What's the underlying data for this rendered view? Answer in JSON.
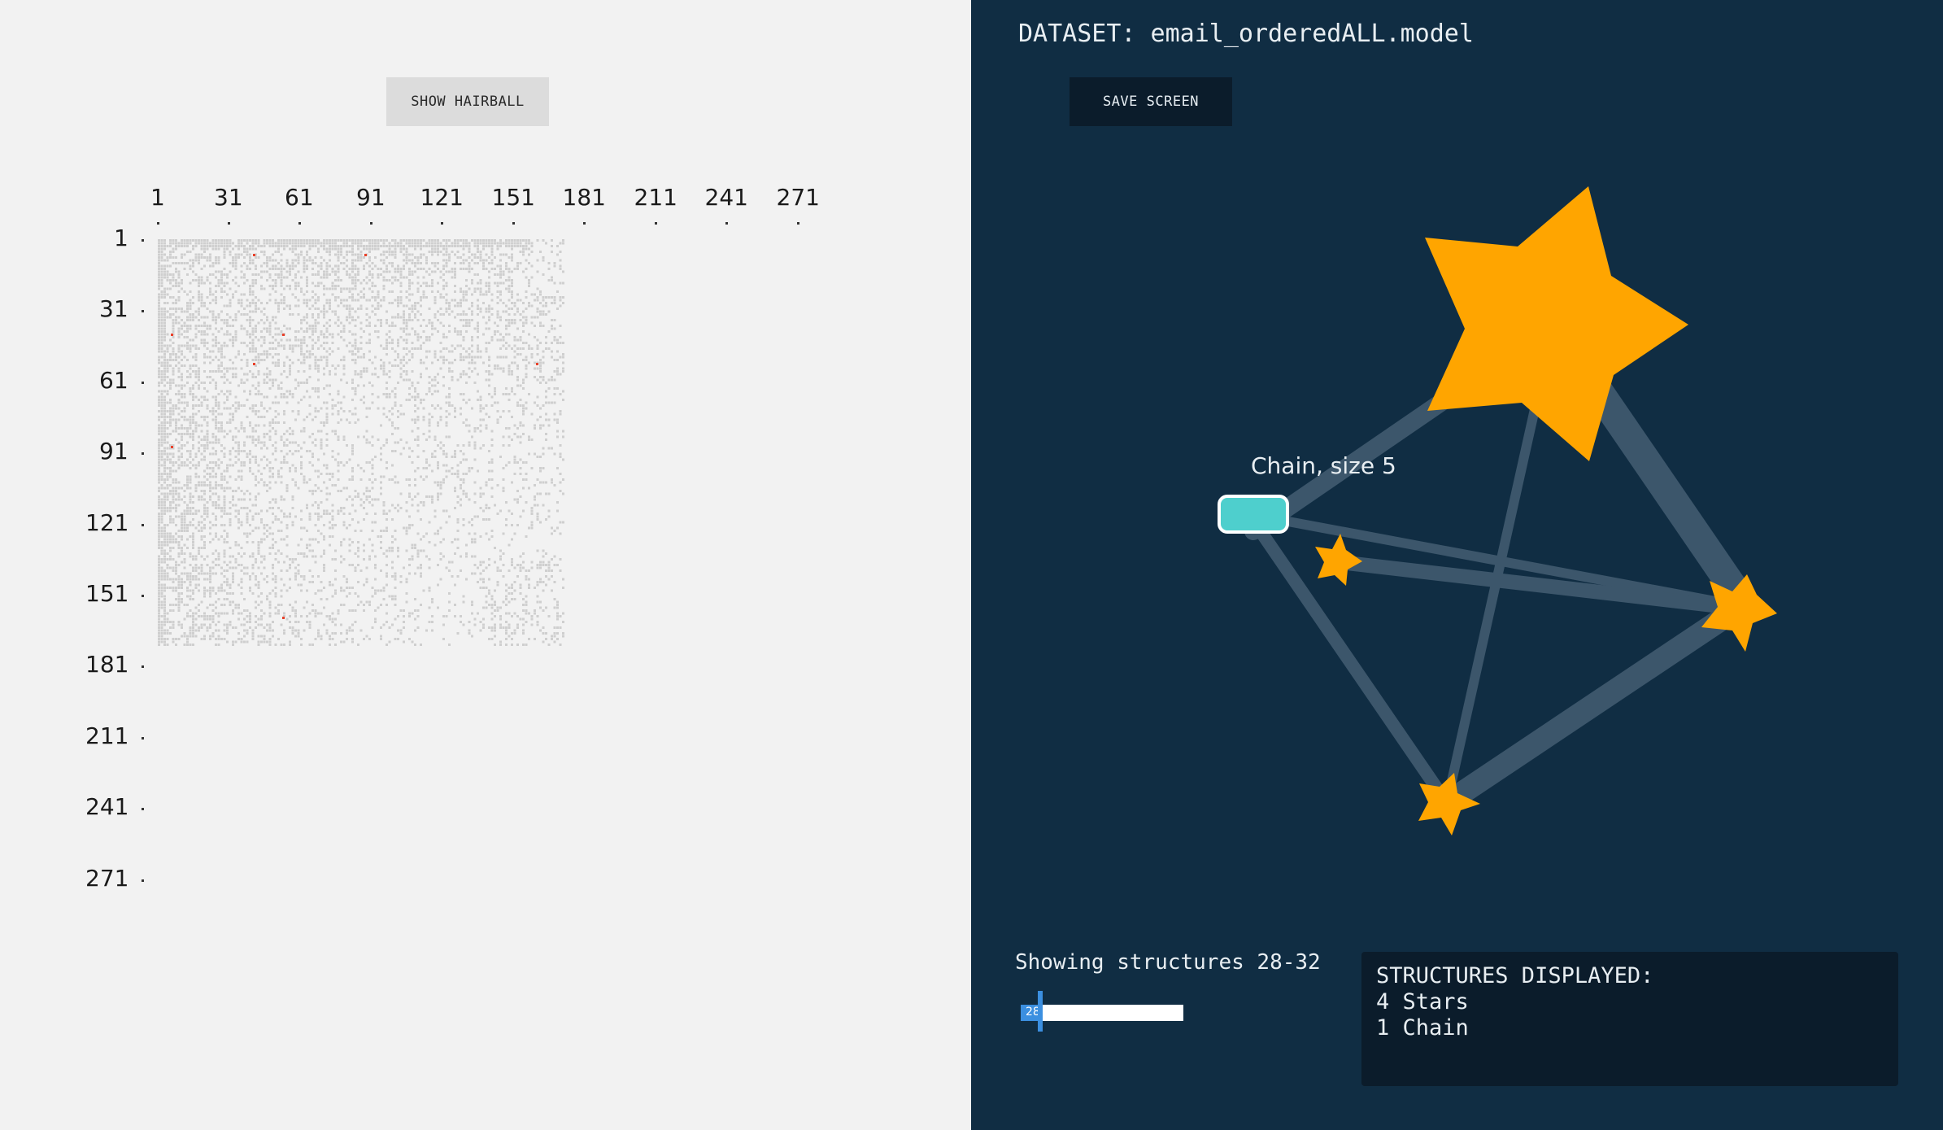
{
  "left_panel": {
    "hairball_button": "SHOW HAIRBALL",
    "matrix": {
      "column_ticks": [
        "1",
        "31",
        "61",
        "91",
        "121",
        "151",
        "181",
        "211",
        "241",
        "271"
      ],
      "row_ticks": [
        "1",
        "31",
        "61",
        "91",
        "121",
        "151",
        "181",
        "211",
        "241",
        "271"
      ],
      "highlight_color": "#e8412a",
      "cell_color": "#cfcfcf"
    }
  },
  "right_panel": {
    "dataset_label": "DATASET: email_orderedALL.model",
    "save_button": "SAVE SCREEN",
    "graph": {
      "chain_label": "Chain, size 5",
      "star_color": "#ffa500",
      "chain_color": "#4ecfcd",
      "edge_color": "#4a6478"
    },
    "slider": {
      "caption": "Showing structures 28-32",
      "value": "28"
    },
    "summary": {
      "heading": "STRUCTURES DISPLAYED:",
      "lines": [
        "4 Stars",
        "1 Chain"
      ]
    }
  }
}
